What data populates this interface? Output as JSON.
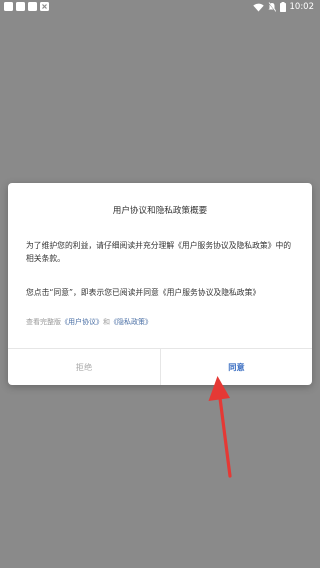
{
  "status_bar": {
    "time": "10:02",
    "icons": [
      "app-square-icon",
      "app-square-icon",
      "app-square-icon",
      "close-square-icon",
      "wifi-icon",
      "silent-icon",
      "battery-icon"
    ]
  },
  "dialog": {
    "title": "用户协议和隐私政策概要",
    "paragraph1": "为了维护您的利益，请仔细阅读并充分理解《用户服务协议及隐私政策》中的相关条款。",
    "paragraph2": "您点击“同意”，即表示您已阅读并同意《用户服务协议及隐私政策》",
    "links_prefix": "查看完整版",
    "link_user_agreement": "《用户协议》",
    "links_and": "和",
    "link_privacy": "《隐私政策》",
    "reject_label": "拒绝",
    "agree_label": "同意"
  },
  "colors": {
    "overlay_background": "#8a8a8a",
    "link": "#4a6fa5",
    "agree_button": "#3a6ec2",
    "annotation_arrow": "#e53935"
  }
}
